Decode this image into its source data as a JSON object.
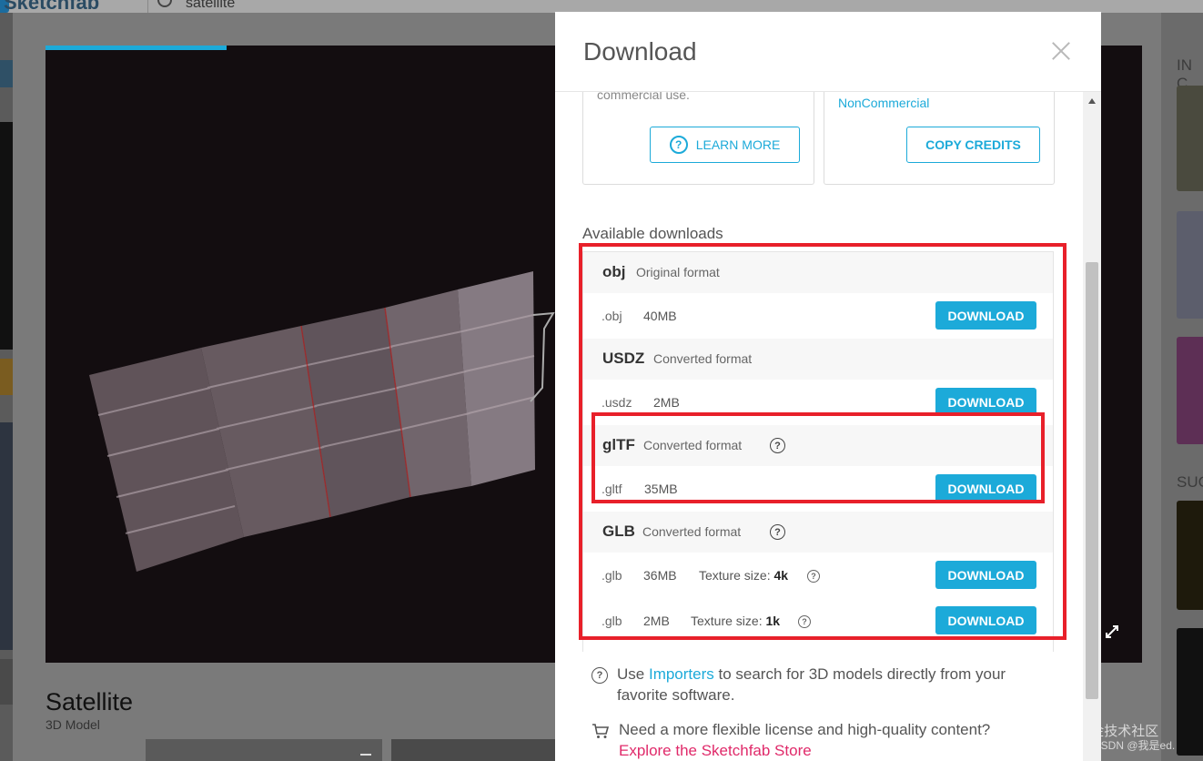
{
  "topbar": {
    "logo": "Sketchfab",
    "search_value": "satellite"
  },
  "viewer": {
    "model_title": "Satellite",
    "model_subtitle": "3D Model"
  },
  "right_column": {
    "label_1": "IN C",
    "label_2": "SUG"
  },
  "modal": {
    "title": "Download",
    "license_left_text": "commercial use.",
    "license_right_text": "NonCommercial",
    "learn_more_label": "LEARN MORE",
    "copy_credits_label": "COPY CREDITS",
    "available_label": "Available downloads",
    "formats": [
      {
        "name": "obj",
        "desc": "Original format",
        "files": [
          {
            "ext": ".obj",
            "size": "40MB",
            "button": "DOWNLOAD"
          }
        ]
      },
      {
        "name": "USDZ",
        "desc": "Converted format",
        "files": [
          {
            "ext": ".usdz",
            "size": "2MB",
            "button": "DOWNLOAD"
          }
        ]
      },
      {
        "name": "glTF",
        "desc": "Converted format",
        "files": [
          {
            "ext": ".gltf",
            "size": "35MB",
            "button": "DOWNLOAD"
          }
        ]
      },
      {
        "name": "GLB",
        "desc": "Converted format",
        "files": [
          {
            "ext": ".glb",
            "size": "36MB",
            "texture_label": "Texture size:",
            "texture_value": "4k",
            "button": "DOWNLOAD"
          },
          {
            "ext": ".glb",
            "size": "2MB",
            "texture_label": "Texture size:",
            "texture_value": "1k",
            "button": "DOWNLOAD"
          }
        ]
      }
    ],
    "importers_note_pre": "Use",
    "importers_link": "Importers",
    "importers_note_post": "to search for 3D models directly from your",
    "importers_note_line2": "favorite software.",
    "store_note": "Need a more flexible license and high-quality content?",
    "store_link": "Explore the Sketchfab Store"
  },
  "watermark": {
    "line1": "@稀土掘金技术社区",
    "line2": "CSDN @我是ed."
  },
  "colors": {
    "accent": "#1caad9",
    "highlight": "#e8202a",
    "store_link": "#e02a6a"
  }
}
